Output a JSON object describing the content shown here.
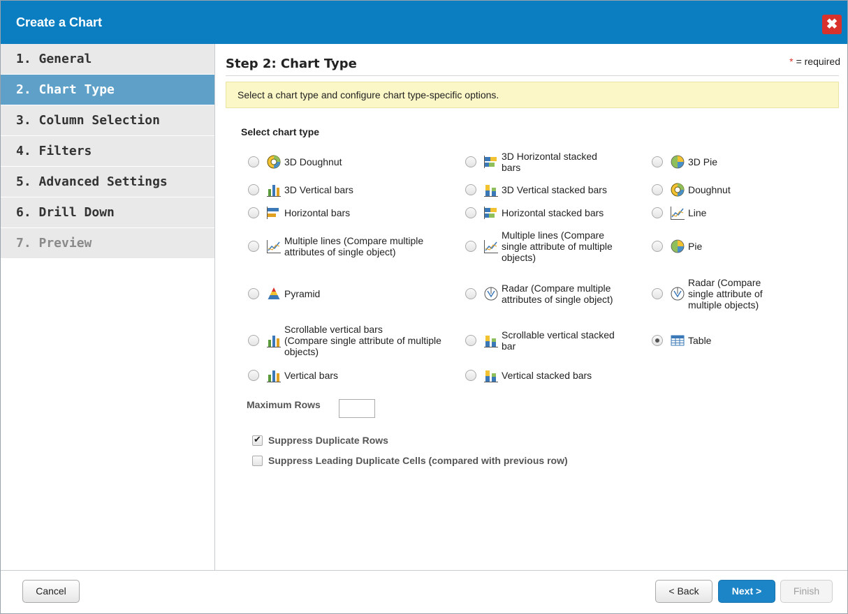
{
  "window": {
    "title": "Create a Chart",
    "close_label": "✖"
  },
  "sidebar": {
    "items": [
      {
        "label": "1. General"
      },
      {
        "label": "2. Chart Type"
      },
      {
        "label": "3. Column Selection"
      },
      {
        "label": "4. Filters"
      },
      {
        "label": "5. Advanced Settings"
      },
      {
        "label": "6. Drill Down"
      },
      {
        "label": "7. Preview"
      }
    ]
  },
  "main": {
    "step_title": "Step 2: Chart Type",
    "required_star": "*",
    "required_text": "= required",
    "info": "Select a chart type and configure chart type-specific options.",
    "select_label": "Select chart type",
    "chart_types": [
      {
        "l1": "3D Doughnut",
        "l2": "",
        "l3": "",
        "icon": "doughnut-icon"
      },
      {
        "l1": "3D Horizontal stacked",
        "l2": "bars",
        "l3": "",
        "icon": "horizontal-stacked-bars-icon"
      },
      {
        "l1": "3D Pie",
        "l2": "",
        "l3": "",
        "icon": "pie-icon"
      },
      {
        "l1": "3D Vertical bars",
        "l2": "",
        "l3": "",
        "icon": "vertical-bars-icon"
      },
      {
        "l1": "3D Vertical stacked bars",
        "l2": "",
        "l3": "",
        "icon": "vertical-stacked-bars-icon"
      },
      {
        "l1": "Doughnut",
        "l2": "",
        "l3": "",
        "icon": "doughnut-icon"
      },
      {
        "l1": "Horizontal bars",
        "l2": "",
        "l3": "",
        "icon": "horizontal-bars-icon"
      },
      {
        "l1": "Horizontal stacked bars",
        "l2": "",
        "l3": "",
        "icon": "horizontal-stacked-bars-icon"
      },
      {
        "l1": "Line",
        "l2": "",
        "l3": "",
        "icon": "line-chart-icon"
      },
      {
        "l1": "Multiple lines (Compare multiple",
        "l2": "attributes of single object)",
        "l3": "",
        "icon": "line-chart-icon"
      },
      {
        "l1": "Multiple lines (Compare",
        "l2": "single attribute of multiple",
        "l3": "objects)",
        "icon": "line-chart-icon"
      },
      {
        "l1": "Pie",
        "l2": "",
        "l3": "",
        "icon": "pie-icon"
      },
      {
        "l1": "Pyramid",
        "l2": "",
        "l3": "",
        "icon": "pyramid-icon"
      },
      {
        "l1": "Radar (Compare multiple",
        "l2": "attributes of single object)",
        "l3": "",
        "icon": "radar-icon"
      },
      {
        "l1": "Radar (Compare",
        "l2": "single attribute of",
        "l3": "multiple objects)",
        "icon": "radar-icon"
      },
      {
        "l1": "Scrollable vertical bars",
        "l2": "(Compare single attribute of multiple",
        "l3": "objects)",
        "icon": "vertical-bars-icon"
      },
      {
        "l1": "Scrollable vertical stacked",
        "l2": "bar",
        "l3": "",
        "icon": "vertical-stacked-bars-icon"
      },
      {
        "l1": "Table",
        "l2": "",
        "l3": "",
        "icon": "table-icon"
      },
      {
        "l1": "Vertical bars",
        "l2": "",
        "l3": "",
        "icon": "vertical-bars-icon"
      },
      {
        "l1": "Vertical stacked bars",
        "l2": "",
        "l3": "",
        "icon": "vertical-stacked-bars-icon"
      }
    ],
    "selected_chart_type": "Table",
    "max_rows_label": "Maximum Rows",
    "max_rows_value": "",
    "suppress_duplicate_rows": {
      "label": "Suppress Duplicate Rows",
      "checked": true
    },
    "suppress_leading_cells": {
      "label": "Suppress Leading Duplicate Cells (compared with previous row)",
      "checked": false
    }
  },
  "footer": {
    "cancel": "Cancel",
    "back": "< Back",
    "next": "Next >",
    "finish": "Finish"
  },
  "colors": {
    "titlebar": "#0b7ec1",
    "active_nav": "#5fa0c9",
    "info_bg": "#fbf7c6",
    "close": "#d9322c",
    "primary_button": "#1c85c8"
  }
}
